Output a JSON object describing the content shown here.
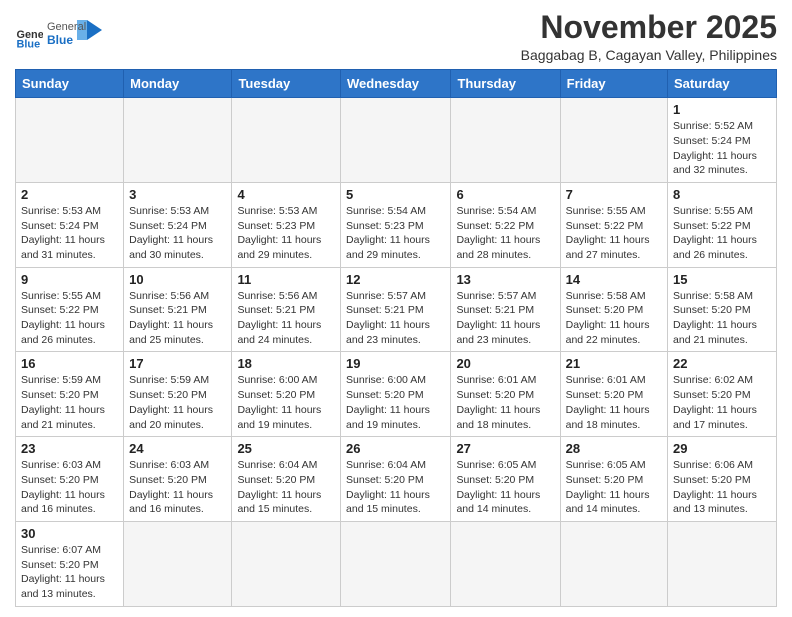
{
  "header": {
    "logo_general": "General",
    "logo_blue": "Blue",
    "month_title": "November 2025",
    "location": "Baggabag B, Cagayan Valley, Philippines"
  },
  "weekdays": [
    "Sunday",
    "Monday",
    "Tuesday",
    "Wednesday",
    "Thursday",
    "Friday",
    "Saturday"
  ],
  "days": {
    "1": {
      "sunrise": "5:52 AM",
      "sunset": "5:24 PM",
      "daylight": "11 hours and 32 minutes."
    },
    "2": {
      "sunrise": "5:53 AM",
      "sunset": "5:24 PM",
      "daylight": "11 hours and 31 minutes."
    },
    "3": {
      "sunrise": "5:53 AM",
      "sunset": "5:24 PM",
      "daylight": "11 hours and 30 minutes."
    },
    "4": {
      "sunrise": "5:53 AM",
      "sunset": "5:23 PM",
      "daylight": "11 hours and 29 minutes."
    },
    "5": {
      "sunrise": "5:54 AM",
      "sunset": "5:23 PM",
      "daylight": "11 hours and 29 minutes."
    },
    "6": {
      "sunrise": "5:54 AM",
      "sunset": "5:22 PM",
      "daylight": "11 hours and 28 minutes."
    },
    "7": {
      "sunrise": "5:55 AM",
      "sunset": "5:22 PM",
      "daylight": "11 hours and 27 minutes."
    },
    "8": {
      "sunrise": "5:55 AM",
      "sunset": "5:22 PM",
      "daylight": "11 hours and 26 minutes."
    },
    "9": {
      "sunrise": "5:55 AM",
      "sunset": "5:22 PM",
      "daylight": "11 hours and 26 minutes."
    },
    "10": {
      "sunrise": "5:56 AM",
      "sunset": "5:21 PM",
      "daylight": "11 hours and 25 minutes."
    },
    "11": {
      "sunrise": "5:56 AM",
      "sunset": "5:21 PM",
      "daylight": "11 hours and 24 minutes."
    },
    "12": {
      "sunrise": "5:57 AM",
      "sunset": "5:21 PM",
      "daylight": "11 hours and 23 minutes."
    },
    "13": {
      "sunrise": "5:57 AM",
      "sunset": "5:21 PM",
      "daylight": "11 hours and 23 minutes."
    },
    "14": {
      "sunrise": "5:58 AM",
      "sunset": "5:20 PM",
      "daylight": "11 hours and 22 minutes."
    },
    "15": {
      "sunrise": "5:58 AM",
      "sunset": "5:20 PM",
      "daylight": "11 hours and 21 minutes."
    },
    "16": {
      "sunrise": "5:59 AM",
      "sunset": "5:20 PM",
      "daylight": "11 hours and 21 minutes."
    },
    "17": {
      "sunrise": "5:59 AM",
      "sunset": "5:20 PM",
      "daylight": "11 hours and 20 minutes."
    },
    "18": {
      "sunrise": "6:00 AM",
      "sunset": "5:20 PM",
      "daylight": "11 hours and 19 minutes."
    },
    "19": {
      "sunrise": "6:00 AM",
      "sunset": "5:20 PM",
      "daylight": "11 hours and 19 minutes."
    },
    "20": {
      "sunrise": "6:01 AM",
      "sunset": "5:20 PM",
      "daylight": "11 hours and 18 minutes."
    },
    "21": {
      "sunrise": "6:01 AM",
      "sunset": "5:20 PM",
      "daylight": "11 hours and 18 minutes."
    },
    "22": {
      "sunrise": "6:02 AM",
      "sunset": "5:20 PM",
      "daylight": "11 hours and 17 minutes."
    },
    "23": {
      "sunrise": "6:03 AM",
      "sunset": "5:20 PM",
      "daylight": "11 hours and 16 minutes."
    },
    "24": {
      "sunrise": "6:03 AM",
      "sunset": "5:20 PM",
      "daylight": "11 hours and 16 minutes."
    },
    "25": {
      "sunrise": "6:04 AM",
      "sunset": "5:20 PM",
      "daylight": "11 hours and 15 minutes."
    },
    "26": {
      "sunrise": "6:04 AM",
      "sunset": "5:20 PM",
      "daylight": "11 hours and 15 minutes."
    },
    "27": {
      "sunrise": "6:05 AM",
      "sunset": "5:20 PM",
      "daylight": "11 hours and 14 minutes."
    },
    "28": {
      "sunrise": "6:05 AM",
      "sunset": "5:20 PM",
      "daylight": "11 hours and 14 minutes."
    },
    "29": {
      "sunrise": "6:06 AM",
      "sunset": "5:20 PM",
      "daylight": "11 hours and 13 minutes."
    },
    "30": {
      "sunrise": "6:07 AM",
      "sunset": "5:20 PM",
      "daylight": "11 hours and 13 minutes."
    }
  },
  "labels": {
    "sunrise": "Sunrise:",
    "sunset": "Sunset:",
    "daylight": "Daylight:"
  }
}
